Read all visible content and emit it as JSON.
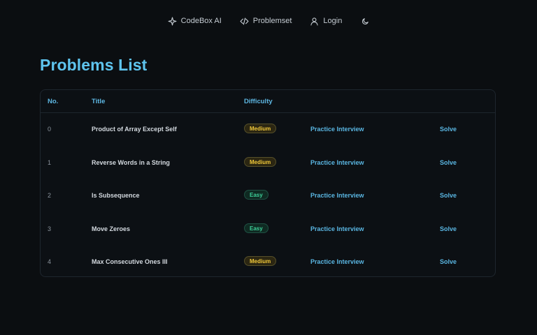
{
  "nav": {
    "items": [
      {
        "label": "CodeBox AI",
        "icon": "sparkle-icon"
      },
      {
        "label": "Problemset",
        "icon": "code-icon"
      },
      {
        "label": "Login",
        "icon": "user-icon"
      }
    ],
    "theme_toggle_icon": "moon-icon"
  },
  "page": {
    "title": "Problems List"
  },
  "table": {
    "headers": {
      "no": "No.",
      "title": "Title",
      "difficulty": "Difficulty"
    },
    "rows": [
      {
        "no": "0",
        "title": "Product of Array Except Self",
        "difficulty": "Medium",
        "practice": "Practice Interview",
        "solve": "Solve"
      },
      {
        "no": "1",
        "title": "Reverse Words in a String",
        "difficulty": "Medium",
        "practice": "Practice Interview",
        "solve": "Solve"
      },
      {
        "no": "2",
        "title": "Is Subsequence",
        "difficulty": "Easy",
        "practice": "Practice Interview",
        "solve": "Solve"
      },
      {
        "no": "3",
        "title": "Move Zeroes",
        "difficulty": "Easy",
        "practice": "Practice Interview",
        "solve": "Solve"
      },
      {
        "no": "4",
        "title": "Max Consecutive Ones III",
        "difficulty": "Medium",
        "practice": "Practice Interview",
        "solve": "Solve"
      }
    ]
  },
  "colors": {
    "background": "#0b0e11",
    "accent": "#5ec4ee",
    "medium": "#f1c93a",
    "easy": "#3dcf98"
  }
}
